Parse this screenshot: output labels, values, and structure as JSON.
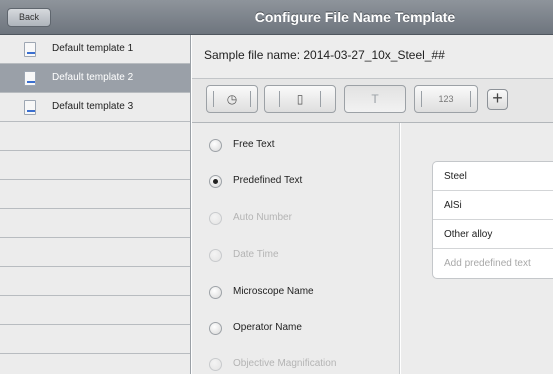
{
  "nav": {
    "back_label": "Back",
    "title": "Configure File Name Template"
  },
  "sidebar": {
    "items": [
      {
        "label": "Default template 1",
        "selected": false
      },
      {
        "label": "Default template 2",
        "selected": true
      },
      {
        "label": "Default template 3",
        "selected": false
      }
    ]
  },
  "sample": {
    "text": "Sample file name:  2014-03-27_10x_Steel_##"
  },
  "toolbar": {
    "segments": [
      {
        "icon": "date-time-icon",
        "glyph": "◷"
      },
      {
        "icon": "microscope-icon",
        "glyph": "▯"
      },
      {
        "icon": "text-icon",
        "glyph": "T"
      },
      {
        "label": "123"
      }
    ],
    "add_glyph": "+"
  },
  "options": [
    {
      "label": "Free Text",
      "selected": false,
      "enabled": true
    },
    {
      "label": "Predefined Text",
      "selected": true,
      "enabled": true
    },
    {
      "label": "Auto Number",
      "selected": false,
      "enabled": false
    },
    {
      "label": "Date Time",
      "selected": false,
      "enabled": false
    },
    {
      "label": "Microscope Name",
      "selected": false,
      "enabled": true
    },
    {
      "label": "Operator Name",
      "selected": false,
      "enabled": true
    },
    {
      "label": "Objective Magnification",
      "selected": false,
      "enabled": false
    }
  ],
  "predefined": {
    "items": [
      "Steel",
      "AlSi",
      "Other alloy"
    ],
    "add_placeholder": "Add predefined text"
  }
}
